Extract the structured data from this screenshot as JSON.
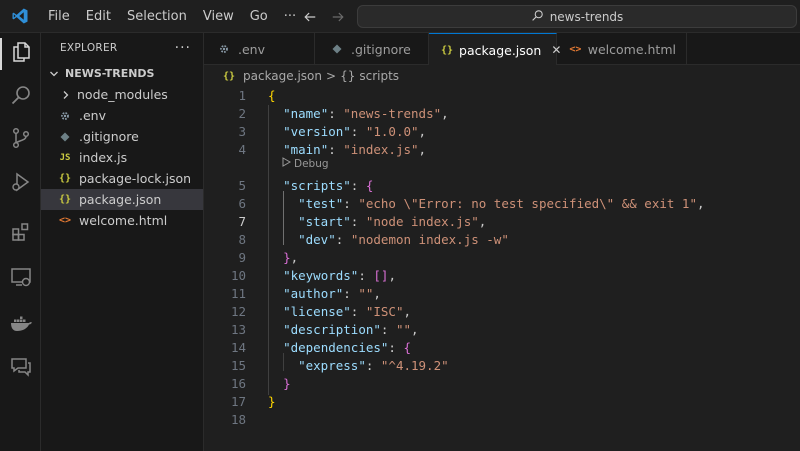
{
  "titlebar": {
    "menu": [
      "File",
      "Edit",
      "Selection",
      "View",
      "Go",
      "···"
    ],
    "search_text": "news-trends"
  },
  "colors": {
    "accent": "#0078d4",
    "background": "#1f1f1f",
    "sidebar": "#181818",
    "selected_row": "#37373d"
  },
  "activity_bar": [
    {
      "name": "explorer",
      "icon": "files-icon",
      "active": true
    },
    {
      "name": "search",
      "icon": "search-icon"
    },
    {
      "name": "source-control",
      "icon": "source-control-icon"
    },
    {
      "name": "run-and-debug",
      "icon": "debug-icon"
    },
    {
      "name": "extensions",
      "icon": "extensions-icon"
    },
    {
      "name": "remote-explorer",
      "icon": "remote-explorer-icon"
    },
    {
      "name": "docker",
      "icon": "docker-icon"
    },
    {
      "name": "chat",
      "icon": "chat-icon"
    }
  ],
  "sidebar": {
    "title": "EXPLORER",
    "more": "···",
    "root": "NEWS-TRENDS",
    "items": [
      {
        "label": "node_modules",
        "type": "folder"
      },
      {
        "label": ".env",
        "type": "env"
      },
      {
        "label": ".gitignore",
        "type": "git"
      },
      {
        "label": "index.js",
        "type": "js",
        "icon_text": "JS"
      },
      {
        "label": "package-lock.json",
        "type": "json",
        "icon_text": "{}"
      },
      {
        "label": "package.json",
        "type": "json",
        "icon_text": "{}",
        "selected": true
      },
      {
        "label": "welcome.html",
        "type": "html",
        "icon_text": "<>"
      }
    ]
  },
  "tabs": [
    {
      "label": ".env",
      "type": "env"
    },
    {
      "label": ".gitignore",
      "type": "git"
    },
    {
      "label": "package.json",
      "type": "json",
      "icon_text": "{}",
      "active": true,
      "close": "✕"
    },
    {
      "label": "welcome.html",
      "type": "html",
      "icon_text": "<>"
    }
  ],
  "breadcrumb": {
    "file": "package.json",
    "file_icon": "{}",
    "separator": ">",
    "symbol_icon": "{}",
    "symbol": "scripts"
  },
  "editor": {
    "current_line": 7,
    "codelens": "Debug",
    "lines": [
      {
        "n": "1",
        "tokens": [
          {
            "t": "{",
            "c": "brace1"
          }
        ]
      },
      {
        "n": "2",
        "tokens": [
          {
            "t": "  "
          },
          {
            "t": "\"name\"",
            "c": "key"
          },
          {
            "t": ": ",
            "c": "punc"
          },
          {
            "t": "\"news-trends\"",
            "c": "str"
          },
          {
            "t": ",",
            "c": "punc"
          }
        ]
      },
      {
        "n": "3",
        "tokens": [
          {
            "t": "  "
          },
          {
            "t": "\"version\"",
            "c": "key"
          },
          {
            "t": ": ",
            "c": "punc"
          },
          {
            "t": "\"1.0.0\"",
            "c": "str"
          },
          {
            "t": ",",
            "c": "punc"
          }
        ]
      },
      {
        "n": "4",
        "tokens": [
          {
            "t": "  "
          },
          {
            "t": "\"main\"",
            "c": "key"
          },
          {
            "t": ": ",
            "c": "punc"
          },
          {
            "t": "\"index.js\"",
            "c": "str"
          },
          {
            "t": ",",
            "c": "punc"
          }
        ]
      },
      {
        "n": "5",
        "tokens": [
          {
            "t": "  "
          },
          {
            "t": "\"scripts\"",
            "c": "key"
          },
          {
            "t": ": ",
            "c": "punc"
          },
          {
            "t": "{",
            "c": "brace2"
          }
        ]
      },
      {
        "n": "6",
        "tokens": [
          {
            "t": "    "
          },
          {
            "t": "\"test\"",
            "c": "key"
          },
          {
            "t": ": ",
            "c": "punc"
          },
          {
            "t": "\"echo \\\"Error: no test specified\\\" && exit 1\"",
            "c": "str"
          },
          {
            "t": ",",
            "c": "punc"
          }
        ]
      },
      {
        "n": "7",
        "tokens": [
          {
            "t": "    "
          },
          {
            "t": "\"start\"",
            "c": "key"
          },
          {
            "t": ": ",
            "c": "punc"
          },
          {
            "t": "\"node index.js\"",
            "c": "str"
          },
          {
            "t": ",",
            "c": "punc"
          }
        ]
      },
      {
        "n": "8",
        "tokens": [
          {
            "t": "    "
          },
          {
            "t": "\"dev\"",
            "c": "key"
          },
          {
            "t": ": ",
            "c": "punc"
          },
          {
            "t": "\"nodemon index.js -w\"",
            "c": "str"
          }
        ]
      },
      {
        "n": "9",
        "tokens": [
          {
            "t": "  "
          },
          {
            "t": "}",
            "c": "brace2"
          },
          {
            "t": ",",
            "c": "punc"
          }
        ]
      },
      {
        "n": "10",
        "tokens": [
          {
            "t": "  "
          },
          {
            "t": "\"keywords\"",
            "c": "key"
          },
          {
            "t": ": ",
            "c": "punc"
          },
          {
            "t": "[]",
            "c": "brace2"
          },
          {
            "t": ",",
            "c": "punc"
          }
        ]
      },
      {
        "n": "11",
        "tokens": [
          {
            "t": "  "
          },
          {
            "t": "\"author\"",
            "c": "key"
          },
          {
            "t": ": ",
            "c": "punc"
          },
          {
            "t": "\"\"",
            "c": "str"
          },
          {
            "t": ",",
            "c": "punc"
          }
        ]
      },
      {
        "n": "12",
        "tokens": [
          {
            "t": "  "
          },
          {
            "t": "\"license\"",
            "c": "key"
          },
          {
            "t": ": ",
            "c": "punc"
          },
          {
            "t": "\"ISC\"",
            "c": "str"
          },
          {
            "t": ",",
            "c": "punc"
          }
        ]
      },
      {
        "n": "13",
        "tokens": [
          {
            "t": "  "
          },
          {
            "t": "\"description\"",
            "c": "key"
          },
          {
            "t": ": ",
            "c": "punc"
          },
          {
            "t": "\"\"",
            "c": "str"
          },
          {
            "t": ",",
            "c": "punc"
          }
        ]
      },
      {
        "n": "14",
        "tokens": [
          {
            "t": "  "
          },
          {
            "t": "\"dependencies\"",
            "c": "key"
          },
          {
            "t": ": ",
            "c": "punc"
          },
          {
            "t": "{",
            "c": "brace2"
          }
        ]
      },
      {
        "n": "15",
        "tokens": [
          {
            "t": "    "
          },
          {
            "t": "\"express\"",
            "c": "key"
          },
          {
            "t": ": ",
            "c": "punc"
          },
          {
            "t": "\"^4.19.2\"",
            "c": "str"
          }
        ]
      },
      {
        "n": "16",
        "tokens": [
          {
            "t": "  "
          },
          {
            "t": "}",
            "c": "brace2"
          }
        ]
      },
      {
        "n": "17",
        "tokens": [
          {
            "t": "}",
            "c": "brace1"
          }
        ]
      },
      {
        "n": "18",
        "tokens": []
      }
    ]
  }
}
